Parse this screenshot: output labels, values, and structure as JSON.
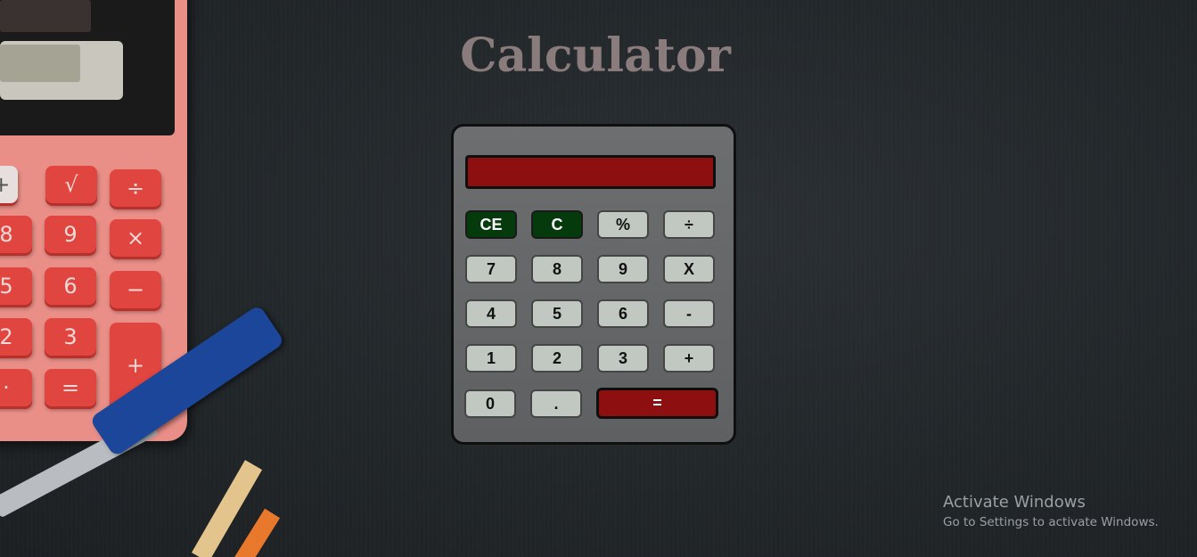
{
  "page": {
    "title": "Calculator"
  },
  "calculator": {
    "display_value": "",
    "keys": [
      {
        "id": "ce",
        "label": "CE",
        "style": "green"
      },
      {
        "id": "c",
        "label": "C",
        "style": "green"
      },
      {
        "id": "percent",
        "label": "%",
        "style": "gray"
      },
      {
        "id": "divide",
        "label": "÷",
        "style": "gray"
      },
      {
        "id": "seven",
        "label": "7",
        "style": "gray"
      },
      {
        "id": "eight",
        "label": "8",
        "style": "gray"
      },
      {
        "id": "nine",
        "label": "9",
        "style": "gray"
      },
      {
        "id": "multiply",
        "label": "X",
        "style": "gray"
      },
      {
        "id": "four",
        "label": "4",
        "style": "gray"
      },
      {
        "id": "five",
        "label": "5",
        "style": "gray"
      },
      {
        "id": "six",
        "label": "6",
        "style": "gray"
      },
      {
        "id": "minus",
        "label": "-",
        "style": "gray"
      },
      {
        "id": "one",
        "label": "1",
        "style": "gray"
      },
      {
        "id": "two",
        "label": "2",
        "style": "gray"
      },
      {
        "id": "three",
        "label": "3",
        "style": "gray"
      },
      {
        "id": "plus",
        "label": "+",
        "style": "gray"
      },
      {
        "id": "zero",
        "label": "0",
        "style": "gray"
      },
      {
        "id": "decimal",
        "label": ".",
        "style": "gray"
      },
      {
        "id": "equals",
        "label": "=",
        "style": "red"
      }
    ],
    "colors": {
      "display": "#8e0f10",
      "clear_keys": "#053a0c",
      "digit_keys": "#c1c8c2",
      "body": "#666869"
    }
  },
  "background_decoration": {
    "keys": [
      {
        "label": "M+"
      },
      {
        "label": "√"
      },
      {
        "label": "÷"
      },
      {
        "label": "8"
      },
      {
        "label": "9"
      },
      {
        "label": "×"
      },
      {
        "label": "5"
      },
      {
        "label": "6"
      },
      {
        "label": "−"
      },
      {
        "label": "2"
      },
      {
        "label": "3"
      },
      {
        "label": "+"
      },
      {
        "label": "·"
      },
      {
        "label": "="
      }
    ]
  },
  "watermark": {
    "title": "Activate Windows",
    "subtitle": "Go to Settings to activate Windows."
  }
}
